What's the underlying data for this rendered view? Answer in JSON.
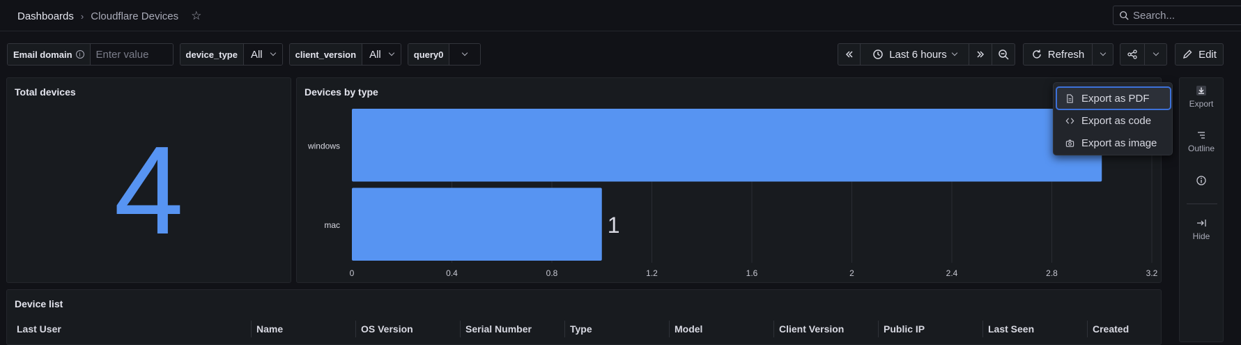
{
  "breadcrumb": {
    "home": "Dashboards",
    "separator": "›",
    "current": "Cloudflare Devices"
  },
  "search": {
    "placeholder": "Search..."
  },
  "variables": [
    {
      "label": "Email domain",
      "value": "",
      "placeholder": "Enter value"
    },
    {
      "label": "device_type",
      "value": "All"
    },
    {
      "label": "client_version",
      "value": "All"
    },
    {
      "label": "query0",
      "value": ""
    }
  ],
  "toolbar": {
    "time_range": "Last 6 hours",
    "refresh_label": "Refresh",
    "edit_label": "Edit"
  },
  "panels": {
    "total_devices": {
      "title": "Total devices",
      "value": "4"
    },
    "devices_by_type": {
      "title": "Devices by type"
    },
    "device_list": {
      "title": "Device list"
    }
  },
  "chart_data": {
    "type": "bar",
    "orientation": "horizontal",
    "title": "Devices by type",
    "categories": [
      "windows",
      "mac"
    ],
    "values": [
      3,
      1
    ],
    "value_labels": [
      "",
      "1"
    ],
    "xlim": [
      0,
      3.2
    ],
    "xticks": [
      "0",
      "0.4",
      "0.8",
      "1.2",
      "1.6",
      "2",
      "2.4",
      "2.8",
      "3.2"
    ],
    "grid": true,
    "color": "#5794f2"
  },
  "export_menu": {
    "items": [
      {
        "label": "Export as PDF",
        "icon": "file-icon",
        "active": true
      },
      {
        "label": "Export as code",
        "icon": "code-icon",
        "active": false
      },
      {
        "label": "Export as image",
        "icon": "camera-icon",
        "active": false
      }
    ]
  },
  "side_panel": {
    "export": "Export",
    "outline": "Outline",
    "hide": "Hide"
  },
  "table": {
    "columns": [
      "Last User",
      "Name",
      "OS Version",
      "Serial Number",
      "Type",
      "Model",
      "Client Version",
      "Public IP",
      "Last Seen",
      "Created"
    ]
  }
}
